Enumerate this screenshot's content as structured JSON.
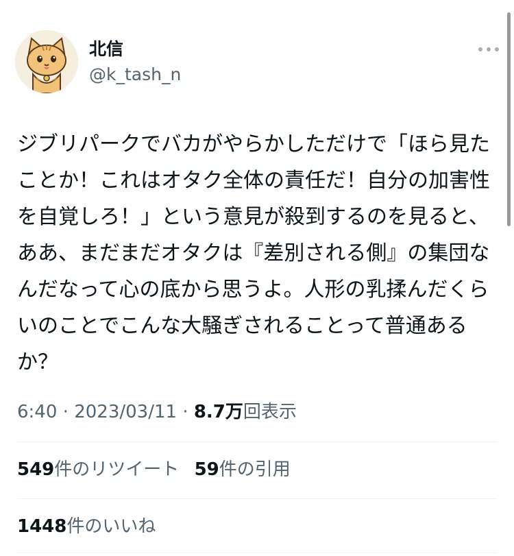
{
  "user": {
    "name": "北信",
    "handle": "@k_tash_n",
    "avatar_icon": "cat-avatar-icon"
  },
  "tweet": {
    "text": "ジブリパークでバカがやらかしただけで「ほら見たことか！これはオタク全体の責任だ！自分の加害性を自覚しろ！」という意見が殺到するのを見ると、ああ、まだまだオタクは『差別される側』の集団なんだなって心の底から思うよ。人形の乳揉んだくらいのことでこんな大騒ぎされることって普通あるか？"
  },
  "meta": {
    "time": "6:40",
    "separator": "·",
    "date": "2023/03/11",
    "views_count": "8.7万",
    "views_label": "回表示"
  },
  "stats": {
    "retweets_count": "549",
    "retweets_label": "件のリツイート",
    "quotes_count": "59",
    "quotes_label": "件の引用",
    "likes_count": "1448",
    "likes_label": "件のいいね"
  },
  "colors": {
    "text_primary": "#0f1419",
    "text_secondary": "#536471",
    "divider": "#eff3f4"
  }
}
